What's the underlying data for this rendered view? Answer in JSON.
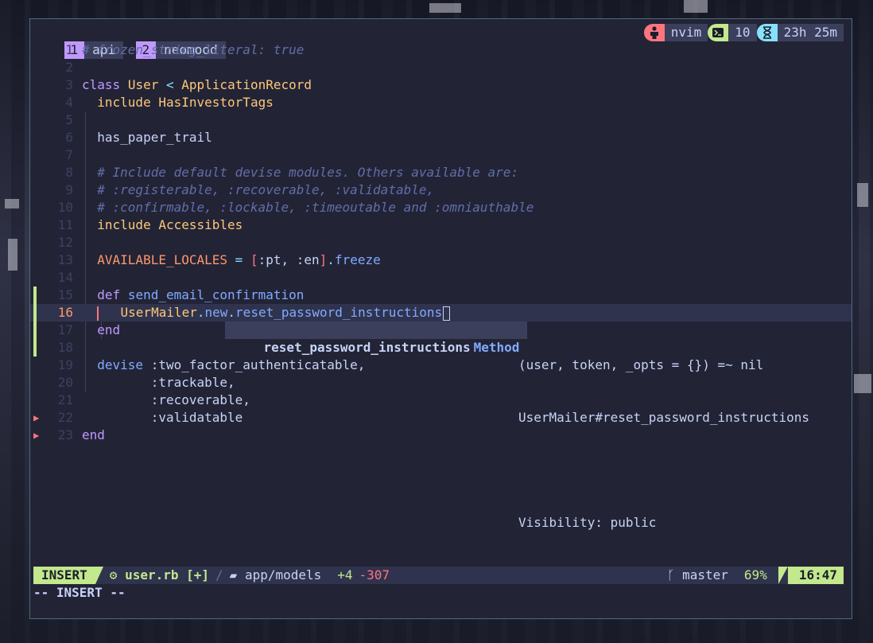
{
  "tmux": {
    "windows": [
      {
        "num": "1",
        "name": "api"
      },
      {
        "num": "2",
        "name": "neomood"
      }
    ],
    "status": {
      "process": "nvim",
      "panes": "10",
      "uptime": "23h 25m"
    },
    "colors": {
      "person": "#ff757f",
      "terminal": "#c3e88d",
      "hourglass": "#86e1fc"
    }
  },
  "code": [
    "# frozen_string_literal: true",
    "",
    "class User < ApplicationRecord",
    "  include HasInvestorTags",
    "",
    "  has_paper_trail",
    "",
    "  # Include default devise modules. Others available are:",
    "  # :registerable, :recoverable, :validatable,",
    "  # :confirmable, :lockable, :timeoutable and :omniauthable",
    "  include Accessibles",
    "",
    "  AVAILABLE_LOCALES = [:pt, :en].freeze",
    "",
    "  def send_email_confirmation",
    "    UserMailer.new.reset_password_instructions",
    "  end",
    "",
    "  devise :two_factor_authenticatable,",
    "         :trackable,",
    "         :recoverable,",
    "         :validatable",
    "end"
  ],
  "line_numbers": [
    "1",
    "2",
    "3",
    "4",
    "5",
    "6",
    "7",
    "8",
    "9",
    "10",
    "11",
    "12",
    "13",
    "14",
    "15",
    "16",
    "17",
    "18",
    "19",
    "20",
    "21",
    "22",
    "23"
  ],
  "completion": {
    "item": "reset_password_instructions",
    "kind": "Method",
    "signature": "(user, token, _opts = {}) =~ nil",
    "owner": "UserMailer#reset_password_instructions",
    "visibility": "Visibility: public"
  },
  "statusline": {
    "mode": "INSERT",
    "file": "user.rb [+]",
    "dir": "app/models",
    "added": "+4",
    "removed": "-307",
    "branch": "master",
    "percent": "69%",
    "time": "16:47"
  },
  "cmdline": "-- INSERT --"
}
